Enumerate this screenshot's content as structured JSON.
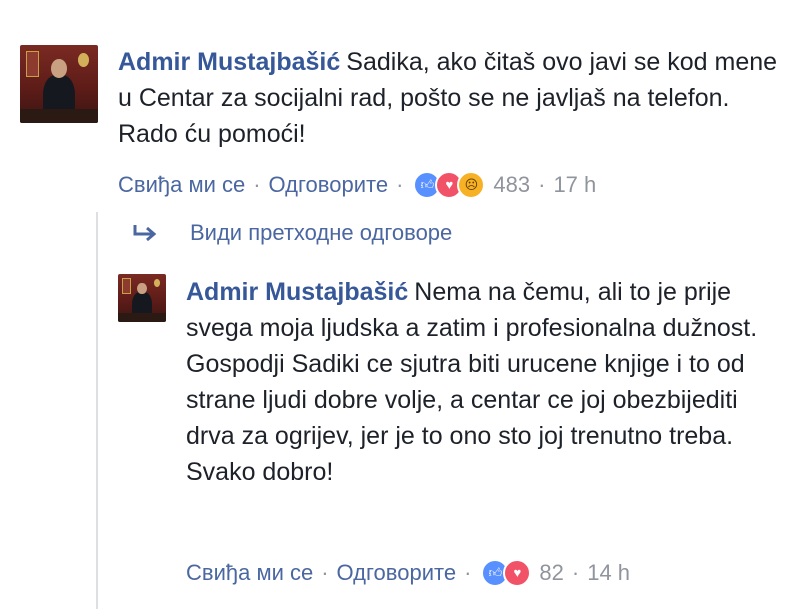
{
  "comments": [
    {
      "author": "Admir Mustajbašić",
      "text": "Sadika, ako čitaš ovo javi se kod mene u Centar za socijalni rad, pošto se ne javljaš na telefon. Rado ću pomoći!",
      "like_label": "Свиђа ми се",
      "reply_label": "Одговорите",
      "reaction_icons": [
        "like-reaction",
        "love-reaction",
        "sad-reaction"
      ],
      "reaction_count": "483",
      "time": "17 h"
    },
    {
      "author": "Admir Mustajbašić",
      "text": "Nema na čemu, ali to je prije svega moja ljudska a zatim i profesionalna dužnost. Gospodji Sadiki ce sjutra biti urucene knjige i to od strane ljudi dobre volje, a centar ce joj obezbijediti drva za ogrijev, jer je to ono sto joj trenutno treba. Svako dobro!",
      "like_label": "Свиђа ми се",
      "reply_label": "Одговорите",
      "reaction_icons": [
        "like-reaction",
        "love-reaction"
      ],
      "reaction_count": "82",
      "time": "14 h"
    }
  ],
  "view_previous_replies": "Види претходне одговоре",
  "separator": "·",
  "colors": {
    "link": "#365899",
    "action": "#4b67a1",
    "muted": "#90949c",
    "text": "#1d2129",
    "like": "#5890ff",
    "love": "#f25268",
    "sad": "#f7b125"
  }
}
